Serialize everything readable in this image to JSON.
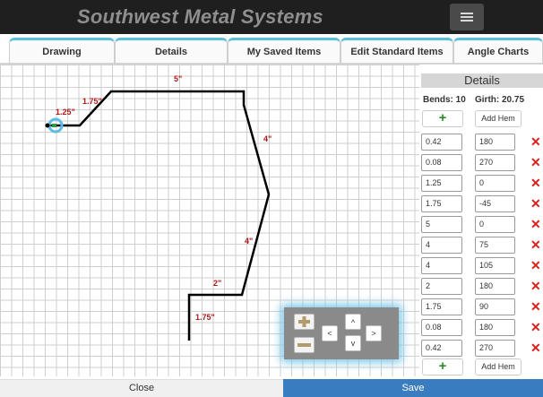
{
  "header": {
    "brand": "Southwest Metal Systems",
    "menu_icon": "hamburger-icon"
  },
  "tabs": [
    "Drawing",
    "Details",
    "My Saved Items",
    "Edit Standard Items",
    "Angle Charts"
  ],
  "drawing": {
    "dimension_labels": [
      "5\"",
      "1.75\"",
      "1.25\"",
      "4\"",
      "4\"",
      "2\"",
      "1.75\""
    ]
  },
  "zoom": {
    "zoom_in_icon": "plus-icon",
    "zoom_out_icon": "minus-icon",
    "left": "<",
    "up": "^",
    "right": ">",
    "down": "v"
  },
  "details": {
    "title": "Details",
    "bends_label": "Bends: 10",
    "girth_label": "Girth: 20.75",
    "add_row_symbol": "+",
    "add_hem_label": "Add Hem",
    "delete_symbol": "✕",
    "rows": [
      {
        "length": "0.42",
        "angle": "180"
      },
      {
        "length": "0.08",
        "angle": "270"
      },
      {
        "length": "1.25",
        "angle": "0"
      },
      {
        "length": "1.75",
        "angle": "-45"
      },
      {
        "length": "5",
        "angle": "0"
      },
      {
        "length": "4",
        "angle": "75"
      },
      {
        "length": "4",
        "angle": "105"
      },
      {
        "length": "2",
        "angle": "180"
      },
      {
        "length": "1.75",
        "angle": "90"
      },
      {
        "length": "0.08",
        "angle": "180"
      },
      {
        "length": "0.42",
        "angle": "270"
      }
    ]
  },
  "footer": {
    "close_label": "Close",
    "save_label": "Save"
  },
  "colors": {
    "header_bg": "#1f1f1f",
    "tab_accent": "#5bc0de",
    "save_bg": "#3a7cc0",
    "delete": "#d9201b",
    "dimension": "#b01818"
  }
}
